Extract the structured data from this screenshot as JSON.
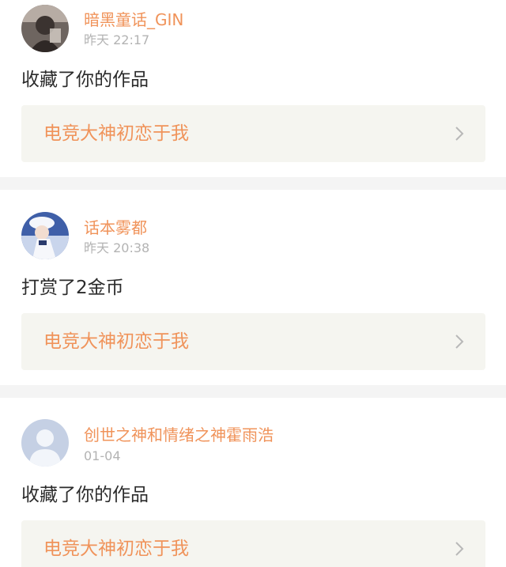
{
  "notifications": [
    {
      "username": "暗黑童话_GIN",
      "time": "昨天 22:17",
      "action": "收藏了你的作品",
      "work_title": "电竞大神初恋于我",
      "avatar_icon": "user-avatar-photo-icon"
    },
    {
      "username": "话本雾都",
      "time": "昨天 20:38",
      "action": "打赏了2金币",
      "work_title": "电竞大神初恋于我",
      "avatar_icon": "user-avatar-anime-icon"
    },
    {
      "username": "创世之神和情绪之神霍雨浩",
      "time": "01-04",
      "action": "收藏了你的作品",
      "work_title": "电竞大神初恋于我",
      "avatar_icon": "default-avatar-icon"
    }
  ],
  "colors": {
    "accent": "#f0935a",
    "muted": "#b3b3b3",
    "text": "#2b2b2b",
    "card_bg": "#f5f5f0",
    "divider": "#f4f4f4"
  }
}
